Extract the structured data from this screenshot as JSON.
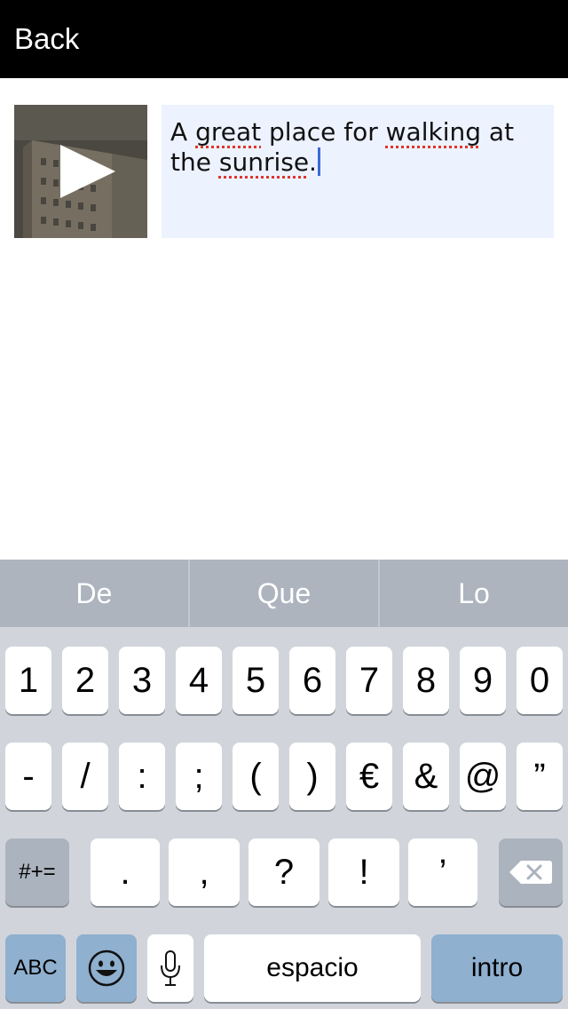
{
  "header": {
    "back_label": "Back"
  },
  "entry": {
    "caption_parts": [
      "A ",
      "great",
      " place for ",
      "walking",
      " at the ",
      "sunrise",
      "."
    ]
  },
  "keyboard": {
    "suggestions": [
      "De",
      "Que",
      "Lo"
    ],
    "row1": [
      "1",
      "2",
      "3",
      "4",
      "5",
      "6",
      "7",
      "8",
      "9",
      "0"
    ],
    "row2": [
      "-",
      "/",
      ":",
      ";",
      "(",
      ")",
      "€",
      "&",
      "@",
      "”"
    ],
    "row3": [
      ".",
      ",",
      "?",
      "!",
      "’"
    ],
    "shift_label": "#+=",
    "abc_label": "ABC",
    "space_label": "espacio",
    "return_label": "intro",
    "icons": {
      "delete": "backspace-icon",
      "emoji": "emoji-icon",
      "mic": "microphone-icon",
      "play": "play-icon"
    }
  }
}
